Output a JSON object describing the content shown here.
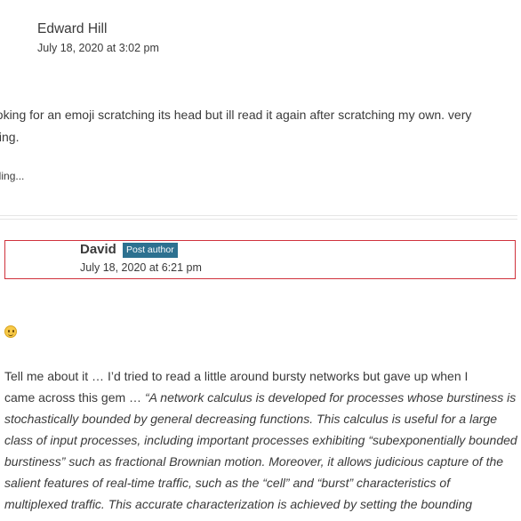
{
  "comment1": {
    "author": "Edward Hill",
    "date": "July 18, 2020 at 3:02 pm",
    "text_line1": "ooking for an emoji scratching its head but ill read it again after scratching my own. very",
    "text_line2": "sting.",
    "loading": "ading..."
  },
  "comment2": {
    "author": "David",
    "badge": "Post author",
    "date": "July 18, 2020 at 6:21 pm",
    "lines": [
      {
        "plain": "Tell me about it … I’d tried to read a little around bursty networks but gave up when I",
        "italic": ""
      },
      {
        "plain": "came across this gem … ",
        "italic": "“A network calculus is developed for processes whose burstiness is"
      },
      {
        "plain": "",
        "italic": "stochastically bounded by general decreasing functions. This calculus is useful for a large"
      },
      {
        "plain": "",
        "italic": "class of input processes, including important processes exhibiting “subexponentially bounded"
      },
      {
        "plain": "",
        "italic": "burstiness” such as fractional Brownian motion. Moreover, it allows judicious capture of the"
      },
      {
        "plain": "",
        "italic": "salient features of real-time traffic, such as the “cell” and “burst” characteristics of"
      },
      {
        "plain": "",
        "italic": "multiplexed traffic. This accurate characterization is achieved by setting the bounding"
      }
    ]
  },
  "colors": {
    "text": "#3a3a3a",
    "badge_bg": "#2d7190",
    "highlight_border": "#d0323c",
    "divider": "#e6e6e6"
  },
  "icons": {
    "emoji": "slightly-smiling-face-icon"
  }
}
